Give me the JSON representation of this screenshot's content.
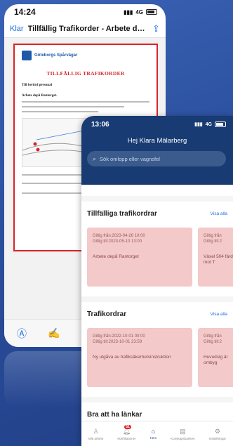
{
  "pdf_viewer": {
    "status_time": "14:24",
    "network": "4G",
    "done_label": "Klar",
    "title": "Tillfällig Trafikorder - Arbete depå...",
    "share_icon": "share-icon",
    "document": {
      "logo_text": "Göteborgs Spårvägar",
      "heading": "TILLFÄLLIG TRAFIKORDER",
      "recipient": "Till berörd personal",
      "subject": "Arbete depå Rantorget."
    },
    "toolbar_icons": [
      "markup-icon",
      "signature-icon"
    ]
  },
  "app": {
    "status_time": "13:06",
    "network": "4G",
    "greeting": "Hej Klara Mälarberg",
    "search_placeholder": "Sök omlopp eller vagnsfel",
    "temporary_orders": {
      "title": "Tillfälliga trafikordrar",
      "link": "Visa alla",
      "cards": [
        {
          "valid_from": "Giltig från:2023-04-26 10:00",
          "valid_to": "Giltig till:2023-05-10 13:00",
          "text": "Arbete depå Rantorget"
        },
        {
          "valid_from": "Giltig från",
          "valid_to": "Giltig till:2",
          "text": "Växel 504 färd mot T"
        }
      ]
    },
    "orders": {
      "title": "Trafikordrar",
      "link": "Visa alla",
      "cards": [
        {
          "valid_from": "Giltig från:2022-10-01 00:00",
          "valid_to": "Giltig till:2023-10-01 23:59",
          "text": "Ny utgåva av trafiksäkerhetsinstruktion"
        },
        {
          "valid_from": "Giltig från",
          "valid_to": "Giltig till:2",
          "text": "Huvudsig är ombyg"
        }
      ]
    },
    "links_section": {
      "title": "Bra att ha länkar"
    },
    "nav": {
      "items": [
        {
          "label": "Mitt arbete",
          "icon": "person-icon"
        },
        {
          "label": "Notifikationer",
          "icon": "bell-icon",
          "badge": "51"
        },
        {
          "label": "Hem",
          "icon": "home-icon"
        },
        {
          "label": "Kunskapsbanken",
          "icon": "document-icon"
        },
        {
          "label": "Inställningar",
          "icon": "gear-icon"
        }
      ],
      "active": "Hem"
    }
  },
  "colors": {
    "background": "#2b4f9d",
    "app_header": "#173b72",
    "card_bg": "#f3c9c9",
    "link": "#1a6fdc",
    "pdf_red": "#d8242b"
  }
}
